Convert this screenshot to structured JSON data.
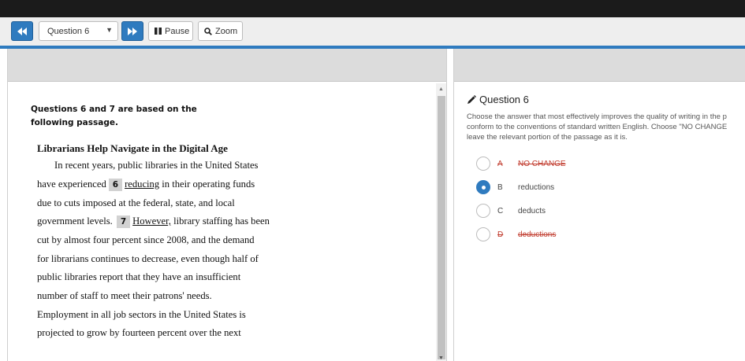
{
  "toolbar": {
    "question_select": "Question 6",
    "pause_label": "Pause",
    "zoom_label": "Zoom",
    "accent": "#2f7bbf"
  },
  "passage": {
    "intro": "Questions 6 and 7 are based on the following passage.",
    "title": "Librarians Help Navigate in the Digital Age",
    "line1": "In recent years, public libraries in the United States",
    "line2_pre": "have experienced",
    "marker6": "6",
    "line2_ul": "reducing",
    "line2_post": " in their operating funds",
    "line3": "due to cuts imposed at the federal, state, and local",
    "line4_pre": "government levels.",
    "marker7": "7",
    "line4_ul": "However,",
    "line4_post": " library staffing has been",
    "line5": "cut by almost four percent since 2008, and the demand",
    "line6": "for librarians continues to decrease, even though half of",
    "line7": "public libraries report that they have an insufficient",
    "line8": "number of staff to meet their patrons' needs.",
    "line9": "Employment in all job sectors in the United States is",
    "line10": "projected to grow by fourteen percent over the next"
  },
  "question": {
    "title": "Question 6",
    "text_line1": "Choose the answer that most effectively improves the quality of writing in the p",
    "text_line2": "conform to the conventions of standard written English. Choose \"NO CHANGE",
    "text_line3": "leave the relevant portion of the passage as it is.",
    "options": [
      {
        "letter": "A",
        "text": "NO CHANGE",
        "struck": true
      },
      {
        "letter": "B",
        "text": "reductions",
        "selected": true
      },
      {
        "letter": "C",
        "text": "deducts"
      },
      {
        "letter": "D",
        "text": "deductions",
        "struck": true
      }
    ]
  }
}
